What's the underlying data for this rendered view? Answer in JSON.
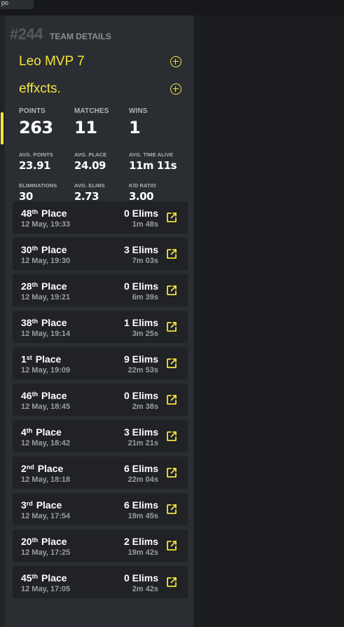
{
  "top_tab": {
    "label": "po"
  },
  "header": {
    "team_number": "#244",
    "title": "TEAM DETAILS"
  },
  "members": [
    {
      "name": "Leo MVP 7",
      "action_icon": "plus-circle-icon"
    },
    {
      "name": "effxcts.",
      "action_icon": "plus-circle-icon"
    }
  ],
  "stats": {
    "points": {
      "label": "POINTS",
      "value": "263"
    },
    "matches": {
      "label": "MATCHES",
      "value": "11"
    },
    "wins": {
      "label": "WINS",
      "value": "1"
    },
    "avg_points": {
      "label": "AVG. POINTS",
      "value": "23.91"
    },
    "avg_place": {
      "label": "AVG. PLACE",
      "value": "24.09"
    },
    "avg_time_alive": {
      "label": "AVG. TIME ALIVE",
      "value": "11m 11s"
    },
    "eliminations": {
      "label": "ELIMINATIONS",
      "value": "30"
    },
    "avg_elims": {
      "label": "AVG. ELIMS",
      "value": "2.73"
    },
    "kd_ratio": {
      "label": "K/D RATIO",
      "value": "3.00"
    }
  },
  "matches": [
    {
      "place": "48",
      "suffix": "th",
      "word": "Place",
      "time": "12 May, 19:33",
      "elims": "0 Elims",
      "alive": "1m 48s"
    },
    {
      "place": "30",
      "suffix": "th",
      "word": "Place",
      "time": "12 May, 19:30",
      "elims": "3 Elims",
      "alive": "7m 03s"
    },
    {
      "place": "28",
      "suffix": "th",
      "word": "Place",
      "time": "12 May, 19:21",
      "elims": "0 Elims",
      "alive": "6m 39s"
    },
    {
      "place": "38",
      "suffix": "th",
      "word": "Place",
      "time": "12 May, 19:14",
      "elims": "1 Elims",
      "alive": "3m 25s"
    },
    {
      "place": "1",
      "suffix": "st",
      "word": "Place",
      "time": "12 May, 19:09",
      "elims": "9 Elims",
      "alive": "22m 53s"
    },
    {
      "place": "46",
      "suffix": "th",
      "word": "Place",
      "time": "12 May, 18:45",
      "elims": "0 Elims",
      "alive": "2m 38s"
    },
    {
      "place": "4",
      "suffix": "th",
      "word": "Place",
      "time": "12 May, 18:42",
      "elims": "3 Elims",
      "alive": "21m 21s"
    },
    {
      "place": "2",
      "suffix": "nd",
      "word": "Place",
      "time": "12 May, 18:18",
      "elims": "6 Elims",
      "alive": "22m 04s"
    },
    {
      "place": "3",
      "suffix": "rd",
      "word": "Place",
      "time": "12 May, 17:54",
      "elims": "6 Elims",
      "alive": "19m 45s"
    },
    {
      "place": "20",
      "suffix": "th",
      "word": "Place",
      "time": "12 May, 17:25",
      "elims": "2 Elims",
      "alive": "19m 42s"
    },
    {
      "place": "45",
      "suffix": "th",
      "word": "Place",
      "time": "12 May, 17:05",
      "elims": "0 Elims",
      "alive": "2m 42s"
    }
  ],
  "colors": {
    "accent": "#f5e53c",
    "panel_bg": "#2a2d32",
    "row_bg": "#202226",
    "page_bg": "#1b1d20"
  },
  "icons": {
    "match_link": "external-link-icon"
  }
}
